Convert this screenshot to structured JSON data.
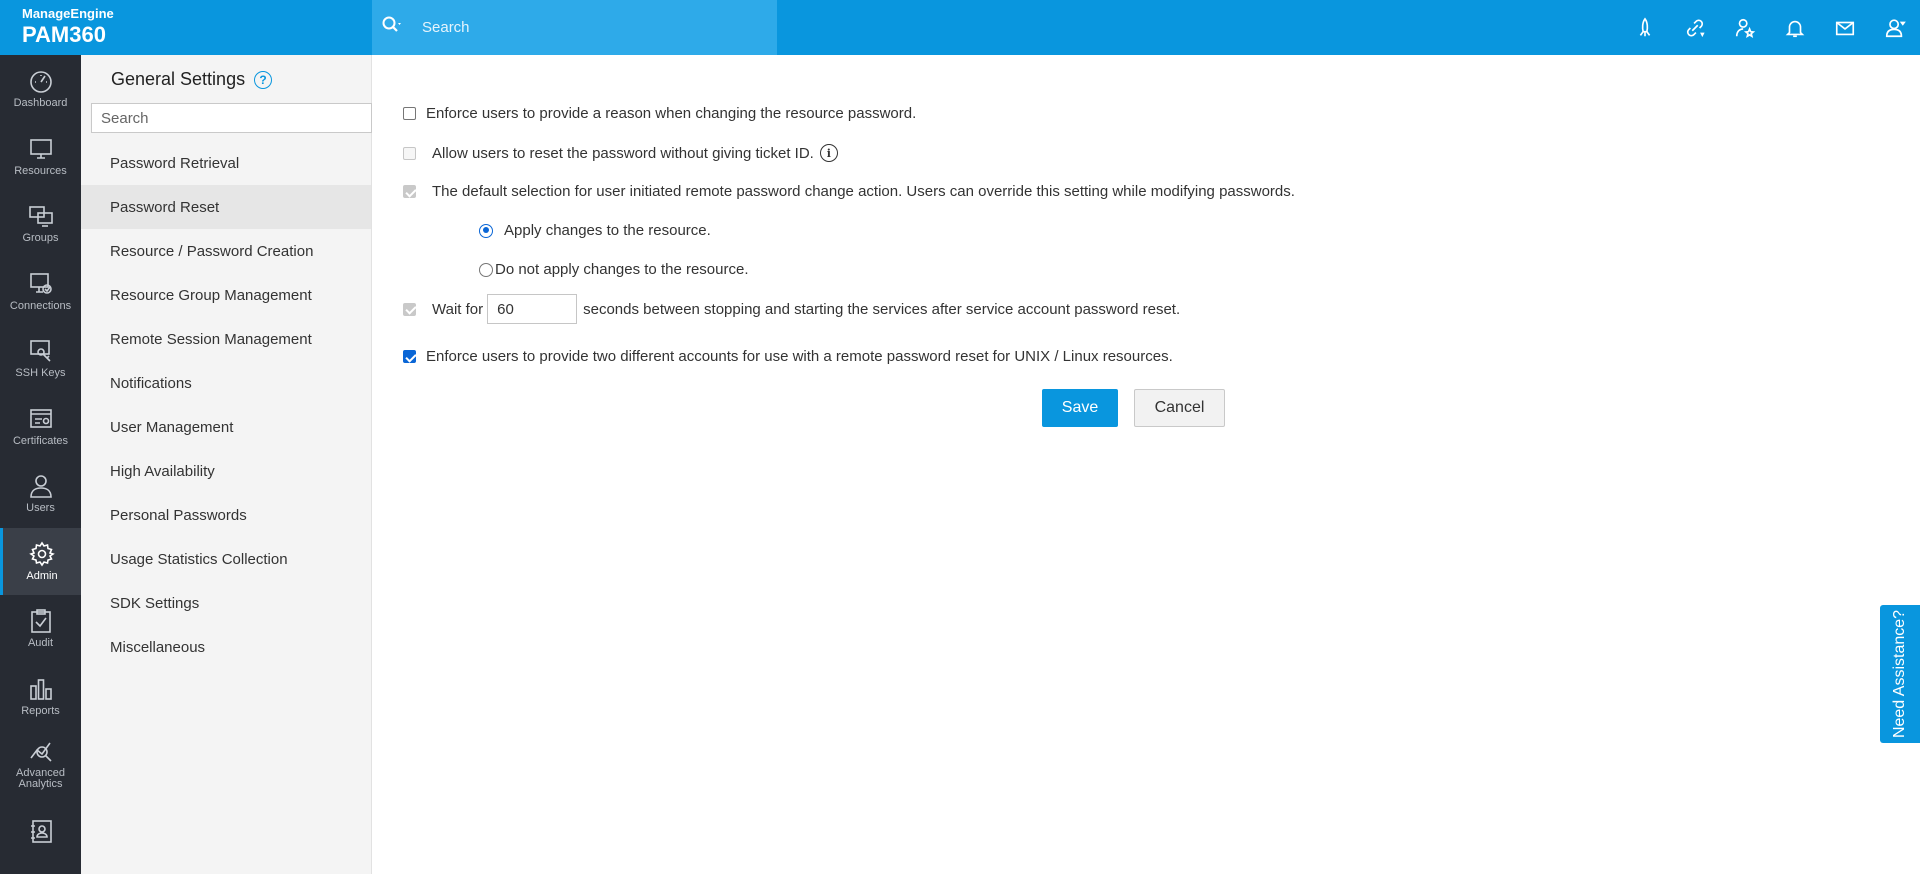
{
  "brand": {
    "company": "ManageEngine",
    "product": "PAM360"
  },
  "topbar": {
    "search_placeholder": "Search",
    "icons": [
      "rocket-icon",
      "link-icon",
      "user-star-icon",
      "bell-icon",
      "mail-icon",
      "user-icon"
    ]
  },
  "rail": {
    "items": [
      {
        "label": "Dashboard"
      },
      {
        "label": "Resources"
      },
      {
        "label": "Groups"
      },
      {
        "label": "Connections"
      },
      {
        "label": "SSH Keys"
      },
      {
        "label": "Certificates"
      },
      {
        "label": "Users"
      },
      {
        "label": "Admin",
        "active": true
      },
      {
        "label": "Audit"
      },
      {
        "label": "Reports"
      },
      {
        "label": "Advanced Analytics"
      },
      {
        "label": ""
      }
    ]
  },
  "sidebar": {
    "title": "General Settings",
    "search_placeholder": "Search",
    "items": [
      {
        "label": "Password Retrieval"
      },
      {
        "label": "Password Reset",
        "active": true
      },
      {
        "label": "Resource / Password Creation"
      },
      {
        "label": "Resource Group Management"
      },
      {
        "label": "Remote Session Management"
      },
      {
        "label": "Notifications"
      },
      {
        "label": "User Management"
      },
      {
        "label": "High Availability"
      },
      {
        "label": "Personal Passwords"
      },
      {
        "label": "Usage Statistics Collection"
      },
      {
        "label": "SDK Settings"
      },
      {
        "label": "Miscellaneous"
      }
    ]
  },
  "settings": {
    "enforce_reason": {
      "label": "Enforce users to provide a reason when changing the resource password.",
      "checked": false
    },
    "allow_reset_no_ticket": {
      "label": "Allow users to reset the password without giving ticket ID.",
      "checked": false,
      "disabled": true
    },
    "default_selection": {
      "label": "The default selection for user initiated remote password change action. Users can override this setting while modifying passwords.",
      "checked": true,
      "disabled": true
    },
    "apply_changes": {
      "label": "Apply changes to the resource.",
      "selected": true
    },
    "do_not_apply": {
      "label": "Do not apply changes to the resource.",
      "selected": false
    },
    "wait_for": {
      "prefix": "Wait for",
      "value": "60",
      "suffix": "seconds between stopping and starting the services after service account password reset.",
      "checked": true,
      "disabled": true
    },
    "two_accounts": {
      "label": "Enforce users to provide two different accounts for use with a remote password reset for UNIX / Linux resources.",
      "checked": true
    }
  },
  "buttons": {
    "save": "Save",
    "cancel": "Cancel"
  },
  "assistance": {
    "label": "Need Assistance?"
  }
}
